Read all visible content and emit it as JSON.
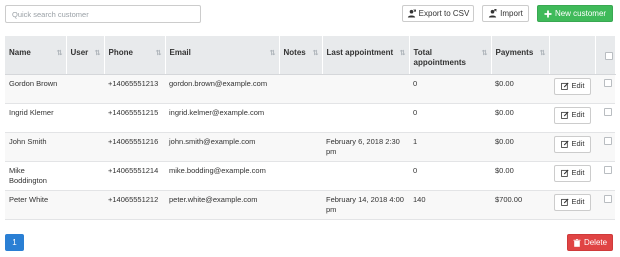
{
  "toolbar": {
    "search_placeholder": "Quick search customer",
    "export_label": "Export to CSV",
    "import_label": "Import",
    "new_customer_label": "New customer"
  },
  "table": {
    "headers": {
      "name": "Name",
      "user": "User",
      "phone": "Phone",
      "email": "Email",
      "notes": "Notes",
      "last_appointment": "Last appointment",
      "total_appointments": "Total appointments",
      "payments": "Payments"
    },
    "edit_label": "Edit",
    "rows": [
      {
        "name": "Gordon Brown",
        "user": "",
        "phone": "+14065551213",
        "email": "gordon.brown@example.com",
        "notes": "",
        "last_appointment": "",
        "total_appointments": "0",
        "payments": "$0.00"
      },
      {
        "name": "Ingrid Klemer",
        "user": "",
        "phone": "+14065551215",
        "email": "ingrid.kelmer@example.com",
        "notes": "",
        "last_appointment": "",
        "total_appointments": "0",
        "payments": "$0.00"
      },
      {
        "name": "John Smith",
        "user": "",
        "phone": "+14065551216",
        "email": "john.smith@example.com",
        "notes": "",
        "last_appointment": "February 6, 2018 2:30 pm",
        "total_appointments": "1",
        "payments": "$0.00"
      },
      {
        "name": "Mike Boddington",
        "user": "",
        "phone": "+14065551214",
        "email": "mike.bodding@example.com",
        "notes": "",
        "last_appointment": "",
        "total_appointments": "0",
        "payments": "$0.00"
      },
      {
        "name": "Peter White",
        "user": "",
        "phone": "+14065551212",
        "email": "peter.white@example.com",
        "notes": "",
        "last_appointment": "February 14, 2018 4:00 pm",
        "total_appointments": "140",
        "payments": "$700.00"
      }
    ]
  },
  "pagination": {
    "current_page": "1"
  },
  "footer": {
    "delete_label": "Delete"
  },
  "colors": {
    "success": "#3fba5a",
    "primary": "#2a7fd4",
    "danger": "#e04444",
    "header_bg": "#e8eaec"
  },
  "icons": [
    "user-export-icon",
    "user-import-icon",
    "plus-icon",
    "sort-icon",
    "edit-icon",
    "trash-icon"
  ]
}
